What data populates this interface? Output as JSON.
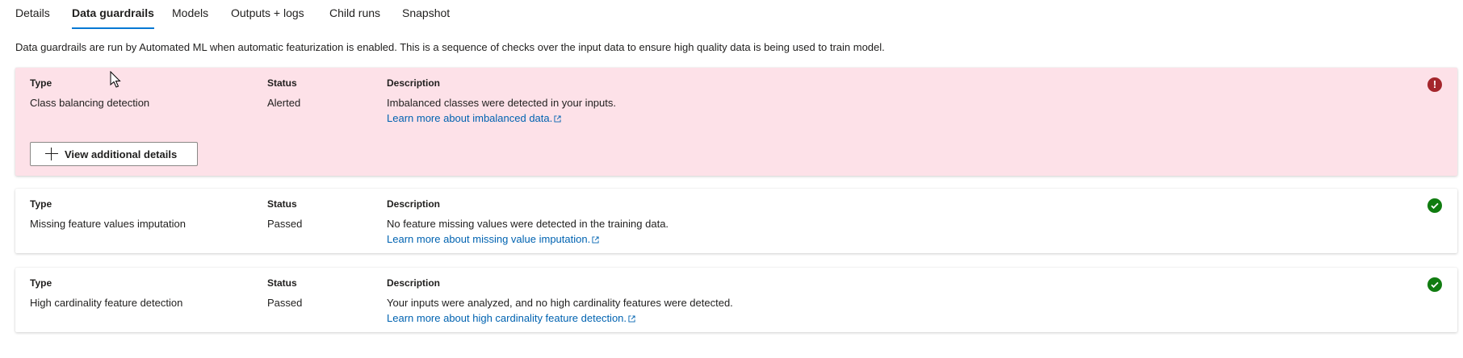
{
  "tabs": [
    {
      "label": "Details"
    },
    {
      "label": "Data guardrails"
    },
    {
      "label": "Models"
    },
    {
      "label": "Outputs + logs"
    },
    {
      "label": "Child runs"
    },
    {
      "label": "Snapshot"
    }
  ],
  "active_tab": "Data guardrails",
  "intro": "Data guardrails are run by Automated ML when automatic featurization is enabled. This is a sequence of checks over the input data to ensure high quality data is being used to train model.",
  "headers": {
    "type": "Type",
    "status": "Status",
    "description": "Description"
  },
  "rows": [
    {
      "type": "Class balancing detection",
      "status": "Alerted",
      "description": "Imbalanced classes were detected in your inputs.",
      "link": "Learn more about imbalanced data.",
      "icon": "error-icon",
      "button": "View additional details"
    },
    {
      "type": "Missing feature values imputation",
      "status": "Passed",
      "description": "No feature missing values were detected in the training data.",
      "link": "Learn more about missing value imputation.",
      "icon": "check-icon"
    },
    {
      "type": "High cardinality feature detection",
      "status": "Passed",
      "description": "Your inputs were analyzed, and no high cardinality features were detected.",
      "link": "Learn more about high cardinality feature detection.",
      "icon": "check-icon"
    }
  ],
  "colors": {
    "alert_bg": "#fde1e8",
    "error": "#a4262c",
    "success": "#107c10",
    "link": "#0063b1",
    "accent": "#0078d4"
  }
}
